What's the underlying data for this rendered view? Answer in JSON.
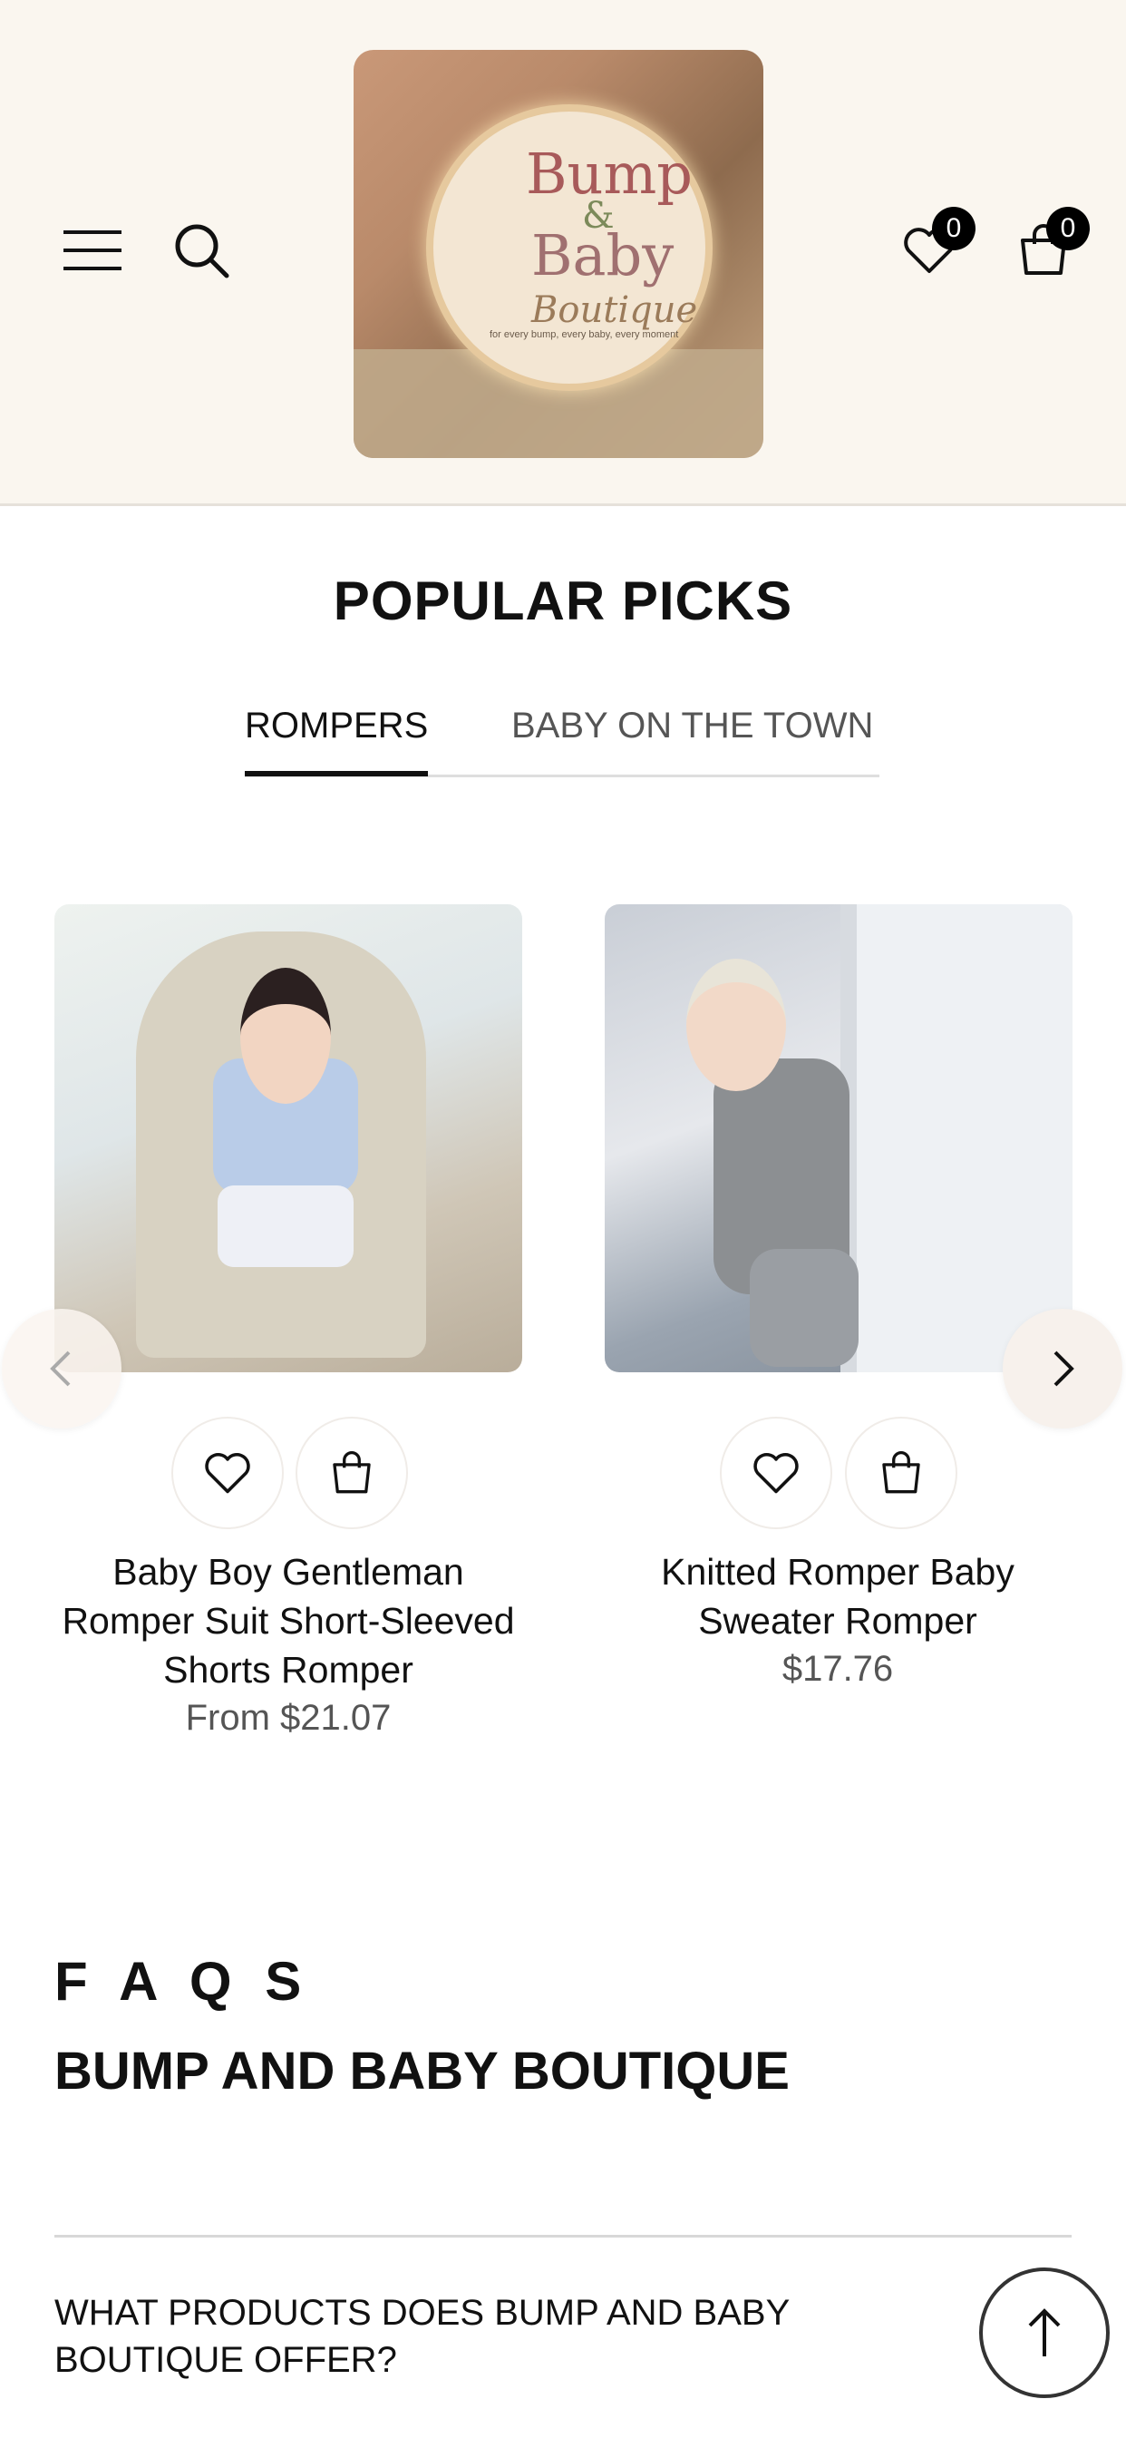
{
  "header": {
    "logo": {
      "line1": "Bump",
      "line2": "&",
      "line3": "Baby",
      "line4": "Boutique",
      "tagline": "for every bump, every baby, every moment"
    },
    "wishlist_count": "0",
    "cart_count": "0"
  },
  "popular": {
    "title": "POPULAR PICKS",
    "tabs": [
      {
        "label": "ROMPERS",
        "active": true
      },
      {
        "label": "BABY ON THE TOWN",
        "active": false
      }
    ],
    "products": [
      {
        "title": "Baby Boy Gentleman Romper Suit Short-Sleeved Shorts Romper",
        "price": "From $21.07"
      },
      {
        "title": "Knitted Romper Baby Sweater Romper",
        "price": "$17.76"
      }
    ]
  },
  "faq": {
    "heading": "F A Q S",
    "subheading": "BUMP AND BABY BOUTIQUE",
    "items": [
      {
        "question": "WHAT PRODUCTS DOES BUMP AND BABY BOUTIQUE OFFER?"
      }
    ]
  },
  "colors": {
    "header_bg": "#faf6ef",
    "text": "#111111",
    "muted": "#555555",
    "badge": "#000000"
  }
}
